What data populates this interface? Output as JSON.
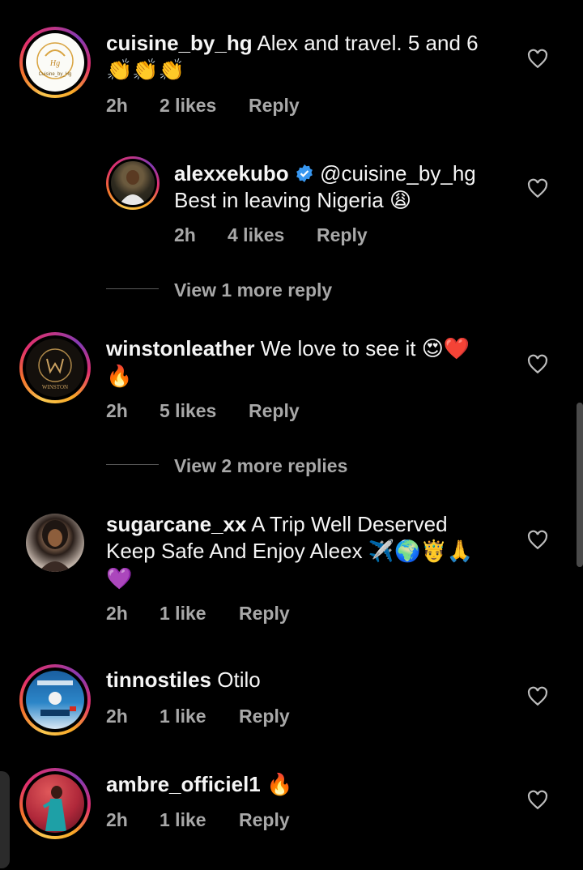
{
  "comments": [
    {
      "username": "cuisine_by_hg",
      "text": "Alex and travel. 5 and 6",
      "emoji": "👏👏👏",
      "time": "2h",
      "likes": "2 likes",
      "reply": "Reply"
    },
    {
      "username": "alexxekubo",
      "mention": "@cuisine_by_hg",
      "text": "Best in leaving Nigeria",
      "emoji": "😩",
      "time": "2h",
      "likes": "4 likes",
      "reply": "Reply"
    },
    {
      "username": "winstonleather",
      "text": "We love to see it",
      "emoji": "😍❤️",
      "emoji2": "🔥",
      "time": "2h",
      "likes": "5 likes",
      "reply": "Reply"
    },
    {
      "username": "sugarcane_xx",
      "text": "A Trip Well Deserved",
      "text2": "Keep Safe And Enjoy Aleex",
      "emoji": "✈️🌍🤴🙏",
      "emoji2": "💜",
      "time": "2h",
      "likes": "1 like",
      "reply": "Reply"
    },
    {
      "username": "tinnostiles",
      "text": "Otilo",
      "time": "2h",
      "likes": "1 like",
      "reply": "Reply"
    },
    {
      "username": "ambre_officiel1",
      "emoji": "🔥",
      "time": "2h",
      "likes": "1 like",
      "reply": "Reply"
    }
  ],
  "view_more": [
    "View 1 more reply",
    "View 2 more replies"
  ],
  "avatar_labels": {
    "cuisine": "Cuisine_by_Hg",
    "winston": "WINSTON"
  },
  "icons": {
    "heart": "heart-outline-icon",
    "verified": "verified-badge-icon"
  },
  "colors": {
    "background": "#000000",
    "text": "#f5f5f5",
    "secondary": "#a8a8a8",
    "verified": "#3897f0"
  }
}
